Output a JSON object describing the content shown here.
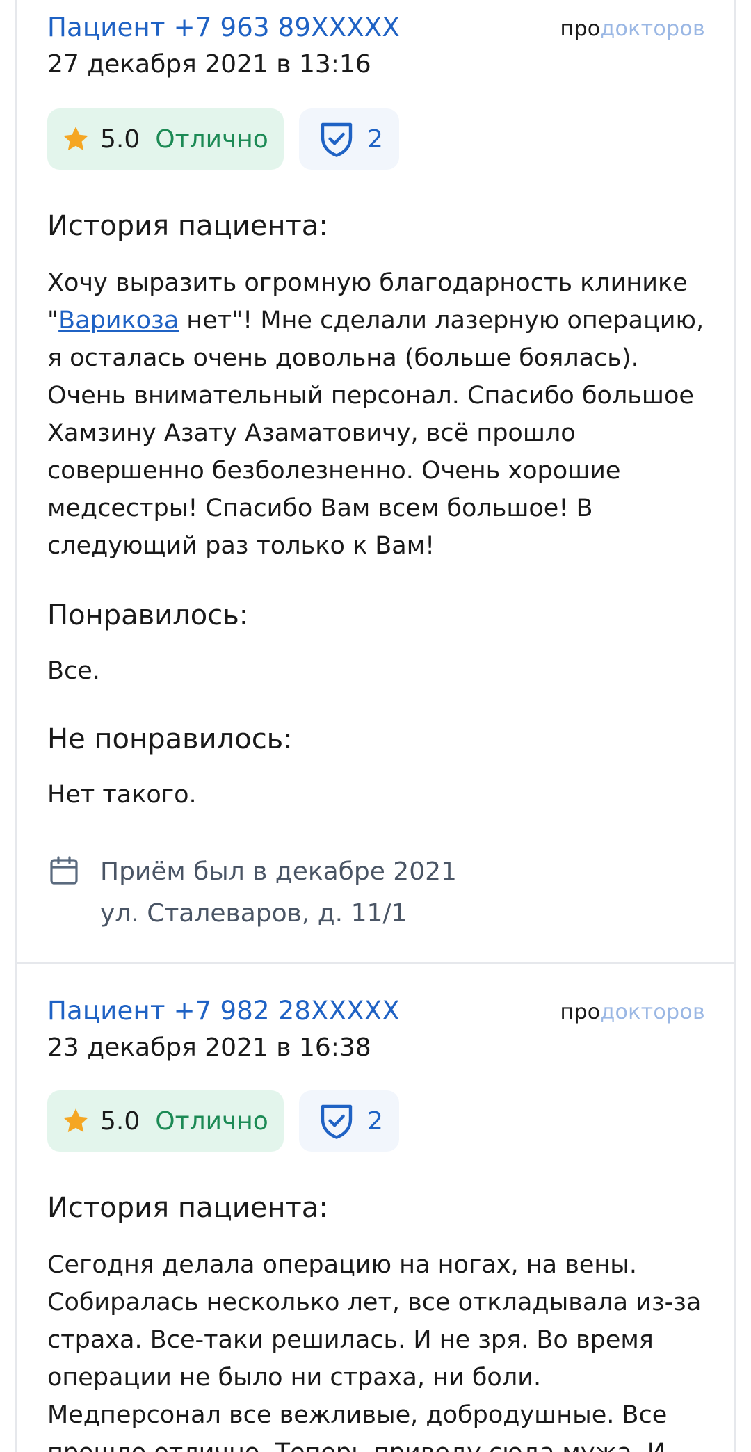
{
  "brand": {
    "pro": "про",
    "rest": "докторов"
  },
  "reviews": [
    {
      "author": "Пациент +7 963 89XXXXX",
      "date": "27 декабря 2021 в 13:16",
      "rating_value": "5.0",
      "rating_text": "Отлично",
      "verified_count": "2",
      "history_title": "История пациента:",
      "history_text_before": "Хочу выразить огромную благодарность клинике \"",
      "history_link": "Варикоза",
      "history_text_after": " нет\"! Мне сделали лазерную операцию, я осталась очень довольна (больше боялась). Очень внимательный персонал. Спасибо большое Хамзину Азату Азаматовичу, всё прошло совершенно безболезненно. Очень хорошие медсестры! Спасибо Вам всем большое! В следующий раз только к Вам!",
      "liked_title": "Понравилось:",
      "liked_text": "Все.",
      "disliked_title": "Не понравилось:",
      "disliked_text": "Нет такого.",
      "visit_date": "Приём был в декабре 2021",
      "visit_address": "ул. Сталеваров, д. 11/1"
    },
    {
      "author": "Пациент +7 982 28XXXXX",
      "date": "23 декабря 2021 в 16:38",
      "rating_value": "5.0",
      "rating_text": "Отлично",
      "verified_count": "2",
      "history_title": "История пациента:",
      "history_text": "Сегодня делала операцию на ногах, на вены. Собиралась несколько лет, все откладывала из-за страха. Все-таки решилась. И не зря. Во время операции не было ни страха, ни боли. Медперсонал все вежливые, добродушные. Все прошло отлично. Теперь приведу сюда мужа. И"
    }
  ],
  "colors": {
    "link": "#1f62c4",
    "rating_bg": "#e3f5ec",
    "rating_text": "#1c8a55",
    "star": "#f5a623",
    "verify_bg": "#f2f6fc"
  }
}
